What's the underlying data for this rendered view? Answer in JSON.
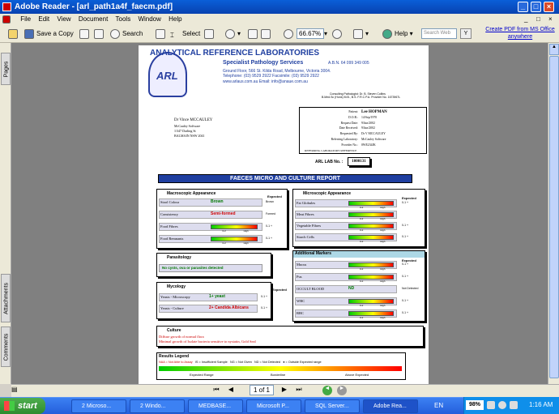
{
  "window": {
    "title": "Adobe Reader - [arl_path1a4f_faecm.pdf]",
    "controls": [
      "_",
      "□",
      "×"
    ],
    "doc_controls": [
      "_",
      "□",
      "×"
    ]
  },
  "menu": [
    "File",
    "Edit",
    "View",
    "Document",
    "Tools",
    "Window",
    "Help"
  ],
  "toolbar": {
    "save_copy": "Save a Copy",
    "search": "Search",
    "select": "Select",
    "zoom": "66.67%",
    "help": "Help",
    "search_web_placeholder": "Search Web",
    "create_pdf": "Create PDF from MS Office anywhere"
  },
  "side_tabs": [
    "Pages",
    "Attachments",
    "Comments"
  ],
  "report": {
    "lab_name": "ANALYTICAL REFERENCE LABORATORIES",
    "subtitle": "Specialist Pathology Services",
    "abn": "A.B.N. 64 099 349 005",
    "address1": "Ground Floor, 566 St. Kilda Road, Melbourne, Victoria 3004.",
    "address2": "Telephone: (03) 9529 2922  Facsimile: (03) 9529 2922",
    "web": "www.arlaus.com.au  Email: info@anaue.com.au",
    "logo_text": "ARL",
    "consulting": "Consulting Pathologist: Dr. B. Steven Collins",
    "consulting2": "B.Med.Sc (Hons) M.B., B.S. F.R.C.P.A. Provider No. 1673967L",
    "doctor": "Dr Vince MCCAULEY",
    "doctor_org": "McCauley Software",
    "doctor_addr1": "1/347 Darling St",
    "doctor_addr2": "BALMAIN NSW 2041",
    "patient_fields": [
      {
        "label": "Patient:",
        "value": "Lee HOPMAN"
      },
      {
        "label": "D.O.B.:",
        "value": "14/Sep/1970"
      },
      {
        "label": "Request Date:",
        "value": "9/Jun/2002"
      },
      {
        "label": "Date Received:",
        "value": "9/Jun/2002"
      },
      {
        "label": "Requested By:",
        "value": "Dr V MCCAULEY"
      },
      {
        "label": "Referring Laboratory:",
        "value": "McCauley Software"
      },
      {
        "label": "Provider No.:",
        "value": "0WE234JK"
      }
    ],
    "referring_ref": "REFERRING LABORATORY REFERENCE",
    "lab_no_label": "ARL LAB No. :",
    "lab_no": "1000131",
    "report_title": "FAECES MICRO AND CULTURE REPORT",
    "macro": {
      "title": "Macroscopic Appearance",
      "expected": "Expected",
      "rows": [
        {
          "label": "Stool Colour",
          "value": "Brown",
          "exp": "Brown"
        },
        {
          "label": "Consistency",
          "value": "Semi-formed",
          "exp": "Formed"
        },
        {
          "label": "Food Fibres",
          "value": "",
          "exp": "0-1 +"
        },
        {
          "label": "Food Remnants",
          "value": "",
          "exp": "0-1 +"
        }
      ]
    },
    "micro": {
      "title": "Microscopic Appearance",
      "expected": "Expected",
      "rows": [
        {
          "label": "Fat Globules",
          "exp": "0-1 +"
        },
        {
          "label": "Meat Fibres",
          "exp": ""
        },
        {
          "label": "Vegetable Fibres",
          "exp": "0-1 +"
        },
        {
          "label": "Starch Cells",
          "exp": "0-1 +"
        }
      ]
    },
    "parasitology": {
      "title": "Parasitology",
      "result": "No cysts, ova or parasites detected"
    },
    "additional": {
      "title": "Additional Markers",
      "expected": "Expected",
      "rows": [
        {
          "label": "Mucus",
          "value": "",
          "exp": "0-1 +"
        },
        {
          "label": "Pus",
          "value": "",
          "exp": "0-1 +"
        },
        {
          "label": "OCCULT BLOOD",
          "value": "ND",
          "exp": "Not Detected"
        },
        {
          "label": "WBC",
          "value": "",
          "exp": "0-1 +"
        },
        {
          "label": "RBC",
          "value": "",
          "exp": "0-1 +"
        }
      ]
    },
    "mycology": {
      "title": "Mycology",
      "expected": "Expected",
      "rows": [
        {
          "label": "Yeasts - Microscopy",
          "value": "1+ yeast",
          "exp": "0-1 +"
        },
        {
          "label": "Yeasts - Culture",
          "value": "2+ Candida Albicans",
          "exp": "0-1 +"
        }
      ]
    },
    "culture": {
      "title": "Culture",
      "line1": "Diffuse growth of normal flora",
      "line2": "Minimal growth of Isolate bacteria sensitive to nystatin, Gold Seal"
    },
    "legend": {
      "title": "Results Legend",
      "items": [
        "NAA = Not Able to Assay",
        "IS = Insufficient Sample",
        "NG = Not Given",
        "ND = Not Detected",
        "● = Outside Expected range"
      ],
      "scale": [
        "Expected Range",
        "Borderline",
        "Above Expected"
      ]
    },
    "bar_labels": {
      "low": "0-2",
      "high": "High",
      "red": "Red"
    }
  },
  "nav": {
    "page": "1 of 1"
  },
  "taskbar": {
    "start": "start",
    "tasks": [
      "2 Microso...",
      "2 Windo...",
      "MEDBASE...",
      "Microsoft P...",
      "SQL Server...",
      "Adobe Rea..."
    ],
    "lang": "EN",
    "battery": "98%",
    "time": "1:16 AM"
  },
  "colors": {
    "title_bar": "#0842b0",
    "report_title_bg": "#1f3fa0",
    "red_value": "#cc0000",
    "green_value": "#007700"
  }
}
